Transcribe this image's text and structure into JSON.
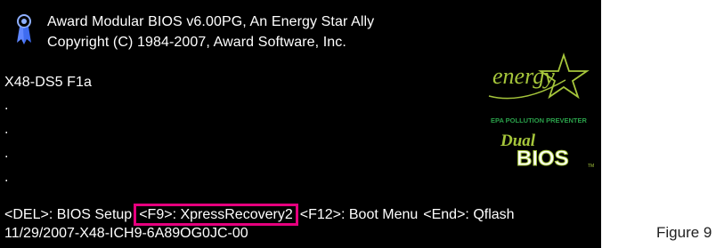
{
  "bios": {
    "vendor_line": "Award Modular BIOS v6.00PG, An Energy Star Ally",
    "copyright_line": "Copyright (C) 1984-2007, Award Software, Inc.",
    "model_line": "X48-DS5 F1a",
    "progress_dots": [
      ".",
      ".",
      ".",
      "."
    ],
    "hotkeys": {
      "del": "<DEL>: BIOS Setup",
      "f9": "<F9>: XpressRecovery2",
      "f12": "<F12>: Boot Menu",
      "end": "<End>: Qflash"
    },
    "date_line": "11/29/2007-X48-ICH9-6A89OG0JC-00"
  },
  "logos": {
    "energy_text": "energy",
    "epa_text": "EPA POLLUTION PREVENTER",
    "dual_text": "Dual",
    "bios_text": "BIOS",
    "tm_text": "TM"
  },
  "figure_label": "Figure 9",
  "colors": {
    "screen_bg": "#000000",
    "text": "#ffffff",
    "highlight": "#e6007e",
    "energy_green": "#a6c63b",
    "epa_green": "#2aa04a"
  }
}
